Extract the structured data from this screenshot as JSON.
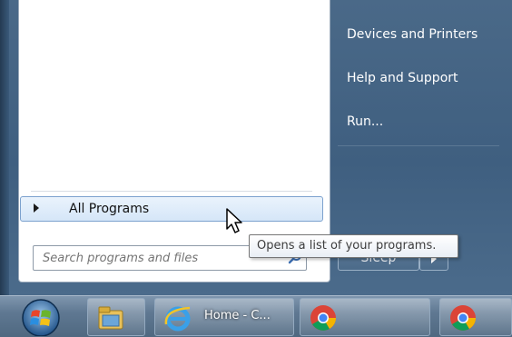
{
  "start_menu": {
    "right_items": [
      {
        "label": "Devices and Printers"
      },
      {
        "label": "Help and Support"
      },
      {
        "label": "Run..."
      }
    ],
    "all_programs_label": "All Programs",
    "search": {
      "placeholder": "Search programs and files"
    },
    "power_button_label": "Sleep"
  },
  "tooltip": {
    "text": "Opens a list of your programs."
  },
  "taskbar": {
    "buttons": [
      {
        "label": "",
        "icon": "file-explorer-icon"
      },
      {
        "label": "Home - C...",
        "icon": "internet-explorer-icon"
      },
      {
        "label": "",
        "icon": "chrome-icon"
      },
      {
        "label": "",
        "icon": "chrome-icon"
      }
    ]
  },
  "colors": {
    "menu_blue": "#3f5f80",
    "highlight": "#d5e6f8",
    "taskbar": "#5f7892"
  }
}
